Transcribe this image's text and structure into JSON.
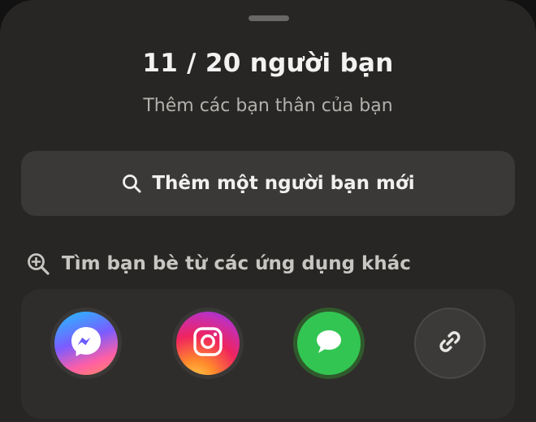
{
  "header": {
    "title": "11 / 20 người bạn",
    "subtitle": "Thêm các bạn thân của bạn"
  },
  "add_friend": {
    "label": "Thêm một người bạn mới",
    "icon": "search-icon"
  },
  "find_section": {
    "label": "Tìm bạn bè từ các ứng dụng khác",
    "icon": "zoom-in-icon"
  },
  "apps": [
    {
      "name": "messenger",
      "icon": "messenger-icon"
    },
    {
      "name": "instagram",
      "icon": "instagram-icon"
    },
    {
      "name": "messages",
      "icon": "message-bubble-icon"
    },
    {
      "name": "copy-link",
      "icon": "link-icon"
    }
  ],
  "colors": {
    "sheet_bg": "#282624",
    "button_bg": "#3b3937",
    "messages_green": "#33c552"
  }
}
